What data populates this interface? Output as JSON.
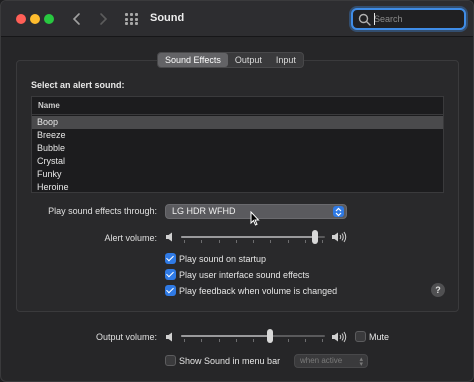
{
  "window": {
    "title": "Sound"
  },
  "search": {
    "placeholder": "Search",
    "value": ""
  },
  "tabs": [
    {
      "label": "Sound Effects",
      "active": true
    },
    {
      "label": "Output",
      "active": false
    },
    {
      "label": "Input",
      "active": false
    }
  ],
  "alert_section": {
    "heading": "Select an alert sound:",
    "column_header": "Name",
    "sounds": [
      "Boop",
      "Breeze",
      "Bubble",
      "Crystal",
      "Funky",
      "Heroine"
    ],
    "selected": "Boop"
  },
  "play_through": {
    "label": "Play sound effects through:",
    "value": "LG HDR WFHD"
  },
  "alert_volume": {
    "label": "Alert volume:",
    "level": 0.95
  },
  "checkboxes": [
    {
      "label": "Play sound on startup",
      "checked": true
    },
    {
      "label": "Play user interface sound effects",
      "checked": true
    },
    {
      "label": "Play feedback when volume is changed",
      "checked": true
    }
  ],
  "help": {
    "label": "?"
  },
  "output_volume": {
    "label": "Output volume:",
    "level": 0.62
  },
  "mute": {
    "label": "Mute",
    "checked": false
  },
  "menu_bar": {
    "label": "Show Sound in menu bar",
    "checked": false,
    "option": "when active"
  },
  "colors": {
    "accent": "#2f7ae5",
    "close": "#ff5f57",
    "minimize": "#febc2e",
    "zoom": "#28c840"
  }
}
